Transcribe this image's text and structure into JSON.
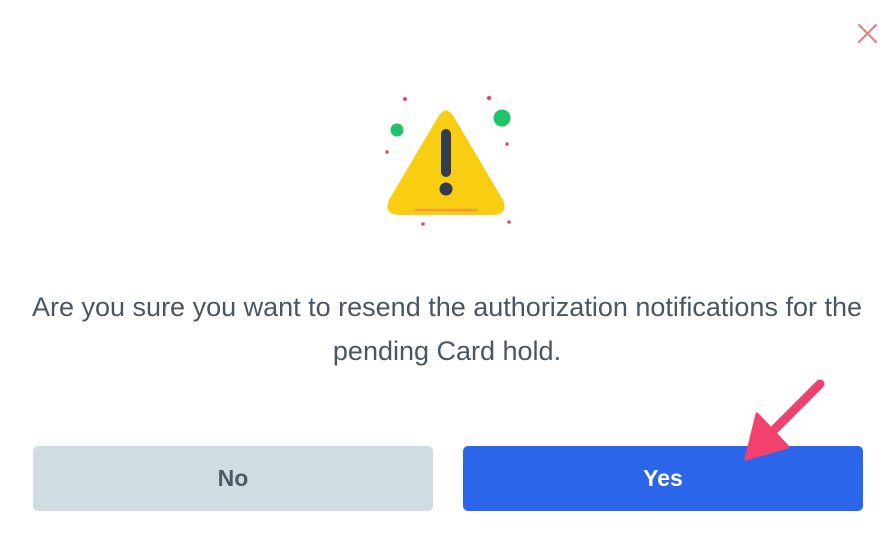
{
  "dialog": {
    "close_icon": "close-icon",
    "illustration_icon": "warning-triangle-icon",
    "message": "Are you sure you want to resend the authorization notifications for the pending Card hold.",
    "buttons": {
      "no_label": "No",
      "yes_label": "Yes"
    }
  },
  "colors": {
    "primary": "#2b66ea",
    "secondary_button": "#cfdde3",
    "warning": "#f9ce12",
    "close_icon": "#f07a74",
    "annotation_arrow": "#f2416d"
  }
}
